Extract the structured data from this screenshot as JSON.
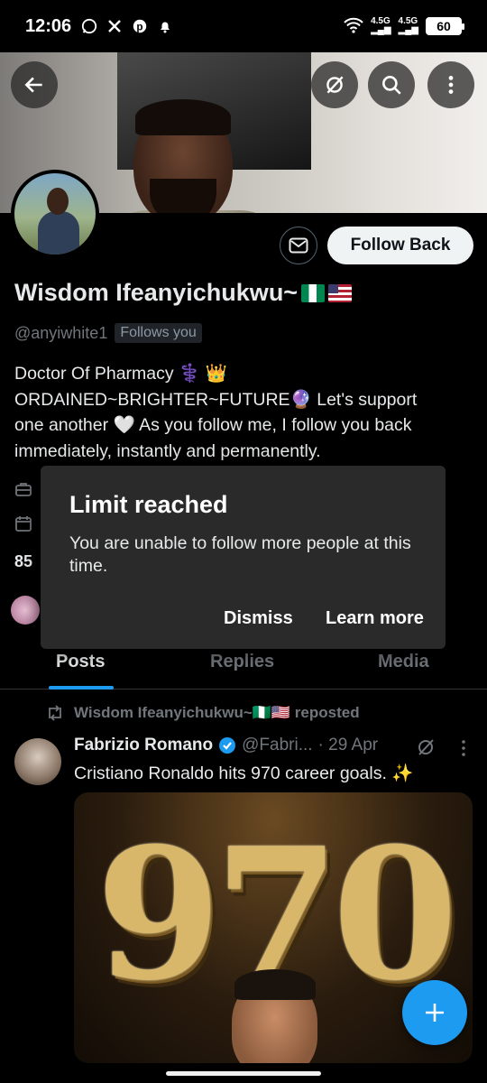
{
  "status_bar": {
    "time": "12:06",
    "network1": "4.5G",
    "network2": "4.5G",
    "battery": "60"
  },
  "profile": {
    "name": "Wisdom Ifeanyichukwu~",
    "handle": "@anyiwhite1",
    "follows_you": "Follows you",
    "bio_line1": "Doctor Of Pharmacy ⚕️  👑",
    "bio_line2": "ORDAINED~BRIGHTER~FUTURE🔮  Let's support",
    "bio_line3": "one another 🤍 As you follow me, I follow you back",
    "bio_line4": "immediately, instantly and permanently.",
    "following_count_partial": "85",
    "follow_back_label": "Follow Back"
  },
  "dialog": {
    "title": "Limit reached",
    "body": "You are unable to follow more people at this time.",
    "dismiss_label": "Dismiss",
    "learn_more_label": "Learn more"
  },
  "tabs": [
    {
      "label": "Posts",
      "active": true
    },
    {
      "label": "Replies",
      "active": false
    },
    {
      "label": "Media",
      "active": false
    }
  ],
  "post": {
    "repost_label": "Wisdom Ifeanyichukwu~🇳🇬🇺🇸 reposted",
    "author": "Fabrizio Romano",
    "handle": "@Fabri...",
    "date": "· 29 Apr",
    "text": "Cristiano Ronaldo hits 970 career goals. ✨",
    "media_text": "970"
  },
  "colors": {
    "accent": "#1d9bf0",
    "background": "#000000",
    "dialog_bg": "#2a2a2a",
    "secondary_text": "#71767b"
  }
}
